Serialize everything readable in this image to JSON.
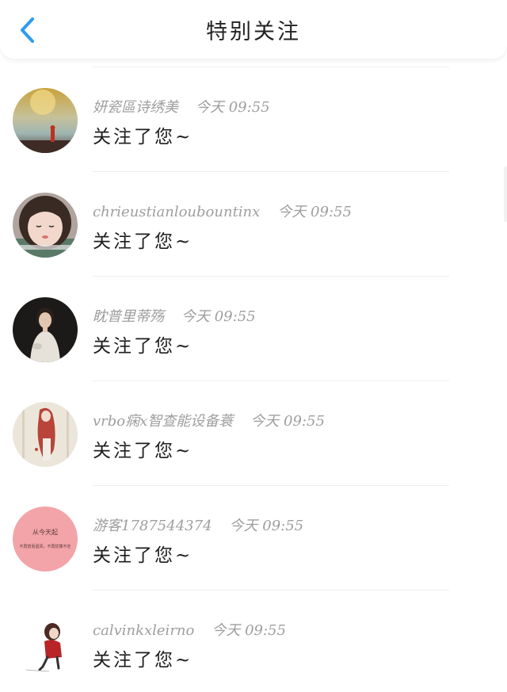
{
  "header": {
    "title": "特别关注",
    "back_icon": "chevron-left-icon",
    "accent": "#2e9bf0"
  },
  "items": [
    {
      "name": "妍瓷區诗绣美",
      "time": "今天 09:55",
      "action": "关注了您~"
    },
    {
      "name": "chrieustianloubountinx",
      "time": "今天 09:55",
      "action": "关注了您~"
    },
    {
      "name": "眈普里蒂殇",
      "time": "今天 09:55",
      "action": "关注了您~"
    },
    {
      "name": "vrbo痫x智查能设备蓑",
      "time": "今天 09:55",
      "action": "关注了您~"
    },
    {
      "name": "游客1787544374",
      "time": "今天 09:55",
      "action": "关注了您~",
      "avatar_text_1": "从今天起",
      "avatar_text_2": "不再暂而留风，不再犹豫不定"
    },
    {
      "name": "calvinkxleirno",
      "time": "今天 09:55",
      "action": "关注了您~"
    }
  ]
}
